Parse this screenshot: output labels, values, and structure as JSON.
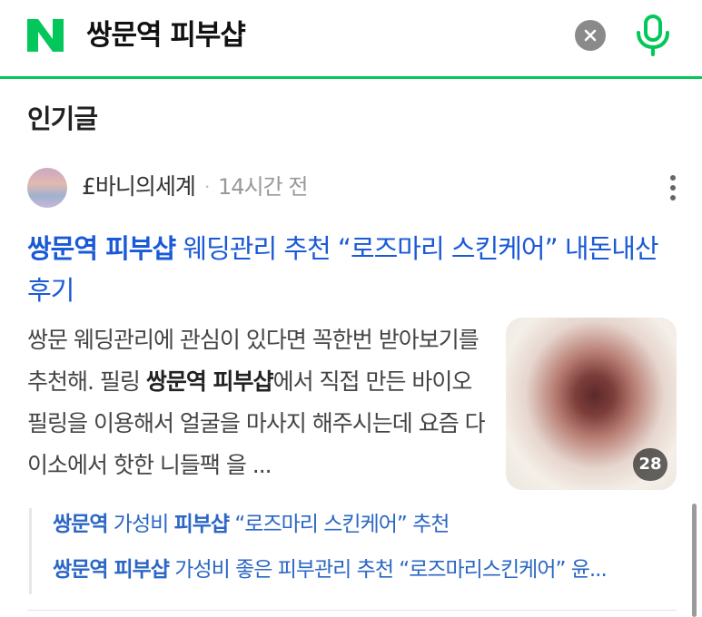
{
  "search": {
    "logo": "N",
    "query": "쌍문역 피부샵",
    "clear_icon": "close-icon",
    "mic_icon": "mic-icon"
  },
  "section": {
    "title": "인기글"
  },
  "post": {
    "author": "£바니의세계",
    "separator": "·",
    "time": "14시간 전",
    "title_highlight": "쌍문역 피부샵",
    "title_rest": " 웨딩관리 추천 “로즈마리 스킨케어” 내돈내산 후기",
    "excerpt_a": "쌍문 웨딩관리에 관심이 있다면 꼭한번 받아보기를 추천해. 필링 ",
    "excerpt_highlight": "쌍문역 피부샵",
    "excerpt_b": "에서 직접 만든 바이오 필링을 이용해서 얼굴을 마사지 해주시는데 요즘 다이소에서 핫한 니들팩 을 ...",
    "image_count": "28"
  },
  "related": [
    {
      "h1": "쌍문역",
      "t1": " 가성비 ",
      "h2": "피부샵",
      "t2": " “로즈마리 스킨케어” 추천"
    },
    {
      "h1": "쌍문역 피부샵",
      "t1": " 가성비 좋은 피부관리 추천 “로즈마리스킨케어” 윤...",
      "h2": "",
      "t2": ""
    }
  ],
  "colors": {
    "brand": "#03c75a",
    "link": "#1a5ad7"
  }
}
